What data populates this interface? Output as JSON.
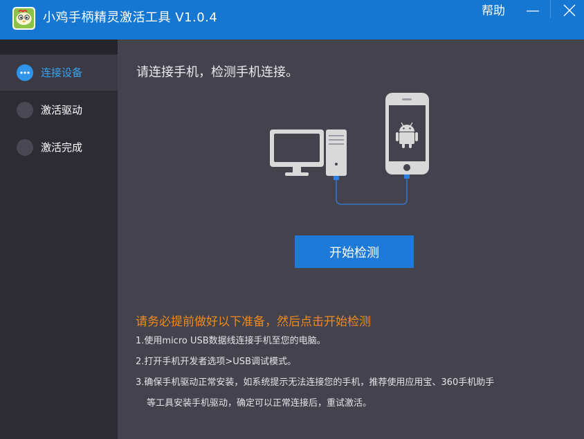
{
  "app": {
    "title": "小鸡手柄精灵激活工具 V1.0.4",
    "help_label": "帮助",
    "accent_color": "#1677d2"
  },
  "sidebar": {
    "steps": [
      {
        "label": "连接设备",
        "state": "active",
        "icon": "more-dots-icon"
      },
      {
        "label": "激活驱动",
        "state": "pending",
        "icon": "circle-icon"
      },
      {
        "label": "激活完成",
        "state": "pending",
        "icon": "circle-icon"
      }
    ]
  },
  "main": {
    "title": "请连接手机，检测手机连接。",
    "illustration_icons": [
      "desktop-computer-icon",
      "usb-cable-icon",
      "android-phone-icon"
    ],
    "start_button_label": "开始检测",
    "notice_title": "请务必提前做好以下准备，然后点击开始检测",
    "notice_color": "#f08a1c",
    "instructions": {
      "line1": "1.使用micro USB数据线连接手机至您的电脑。",
      "line2": "2.打开手机开发者选项>USB调试模式。",
      "line3a": "3.确保手机驱动正常安装，如系统提示无法连接您的手机，推荐使用应用宝、360手机助手",
      "line3b": "等工具安装手机驱动，确定可以正常连接后，重试激活。"
    }
  }
}
